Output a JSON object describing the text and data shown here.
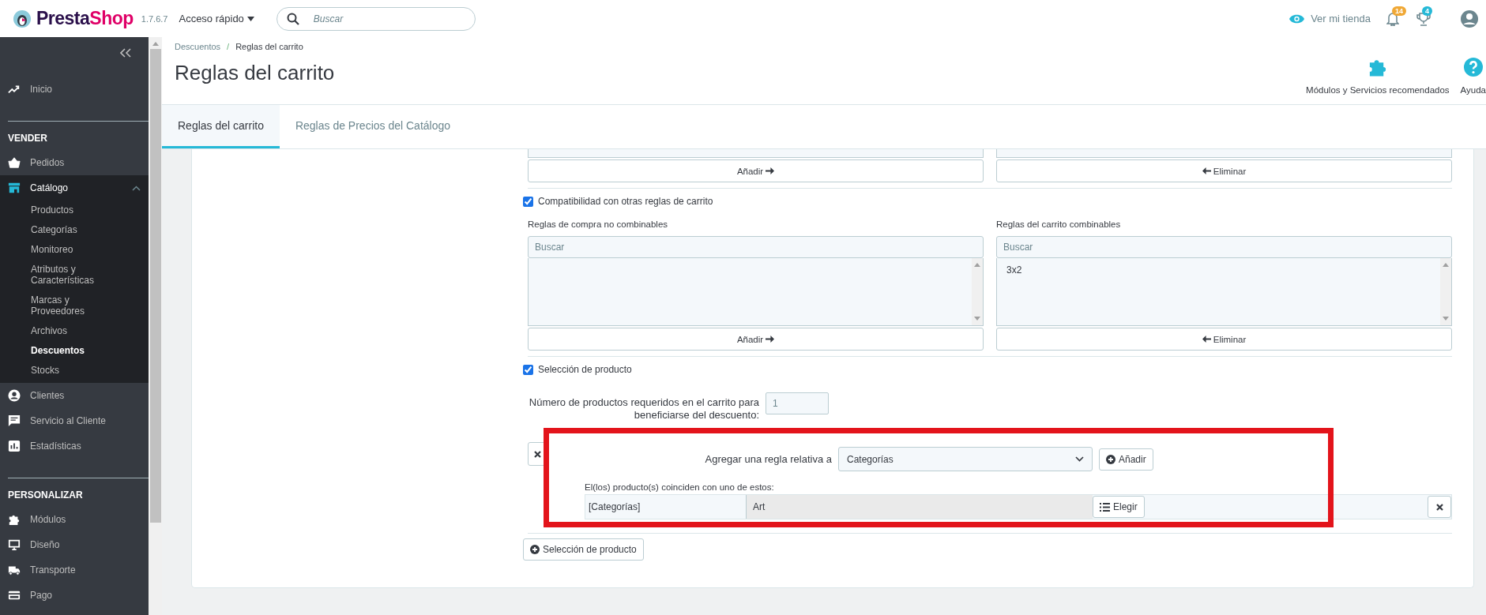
{
  "header": {
    "logo": [
      "Presta",
      "Shop"
    ],
    "version": "1.7.6.7",
    "quick_access": "Acceso rápido",
    "search": {
      "placeholder": "Buscar"
    },
    "view_store": "Ver mi tienda",
    "notifications_badge": "14",
    "trophy_badge": "4"
  },
  "sidebar": {
    "sections": [
      {
        "items": [
          {
            "label": "Inicio",
            "selected": false,
            "expanded": false
          }
        ]
      },
      {
        "heading": "VENDER",
        "items": [
          {
            "label": "Pedidos",
            "selected": false,
            "expanded": false
          },
          {
            "label": "Catálogo",
            "selected": true,
            "expanded": true,
            "children": [
              {
                "label": "Productos",
                "selected": false
              },
              {
                "label": "Categorías",
                "selected": false
              },
              {
                "label": "Monitoreo",
                "selected": false
              },
              {
                "label": "Atributos y Características",
                "selected": false
              },
              {
                "label": "Marcas y Proveedores",
                "selected": false
              },
              {
                "label": "Archivos",
                "selected": false
              },
              {
                "label": "Descuentos",
                "selected": true
              },
              {
                "label": "Stocks",
                "selected": false
              }
            ]
          },
          {
            "label": "Clientes",
            "selected": false,
            "expanded": false
          },
          {
            "label": "Servicio al Cliente",
            "selected": false,
            "expanded": false
          },
          {
            "label": "Estadísticas",
            "selected": false,
            "expanded": false
          }
        ]
      },
      {
        "heading": "PERSONALIZAR",
        "items": [
          {
            "label": "Módulos",
            "selected": false,
            "expanded": false
          },
          {
            "label": "Diseño",
            "selected": false,
            "expanded": false
          },
          {
            "label": "Transporte",
            "selected": false,
            "expanded": false
          },
          {
            "label": "Pago",
            "selected": false,
            "expanded": false
          }
        ]
      }
    ]
  },
  "breadcrumb": {
    "items": [
      "Descuentos",
      "Reglas del carrito"
    ],
    "separator": "/"
  },
  "title": "Reglas del carrito",
  "toolbar": [
    {
      "label": "Módulos y Servicios recomendados",
      "kind": "modules"
    },
    {
      "label": "Ayuda",
      "kind": "help"
    }
  ],
  "tabs": [
    {
      "label": "Reglas del carrito",
      "selected": true
    },
    {
      "label": "Reglas de Precios del Catálogo",
      "selected": false
    }
  ],
  "form": {
    "top_buttons": [
      {
        "label": "Añadir",
        "kind": "add"
      },
      {
        "label": "Eliminar",
        "kind": "remove"
      }
    ],
    "compatibility": {
      "label": "Compatibilidad con otras reglas de carrito",
      "checked": true,
      "lists": [
        {
          "title": "Reglas de compra no combinables",
          "placeholder": "Buscar",
          "button": {
            "label": "Añadir",
            "kind": "add"
          }
        },
        {
          "title": "Reglas del carrito combinables",
          "placeholder": "Buscar",
          "options": [
            "3x2"
          ],
          "button": {
            "label": "Eliminar",
            "kind": "remove"
          }
        }
      ]
    },
    "product_selection": {
      "label": "Selección de producto",
      "checked": true,
      "quantity_label": "Número de productos requeridos en el carrito para beneficiarse del descuento:",
      "quantity": "1",
      "rule_group": {
        "add_rule_label": "Agregar una regla relativa a",
        "rule_type": "Categorías",
        "add_button": "Añadir",
        "match_label": "El(los) producto(s) coinciden con uno de estos:",
        "rules": [
          {
            "type": "[Categorías]",
            "value": "Art",
            "choose_button": "Elegir"
          }
        ]
      },
      "add_group_button": "Selección de producto"
    }
  }
}
